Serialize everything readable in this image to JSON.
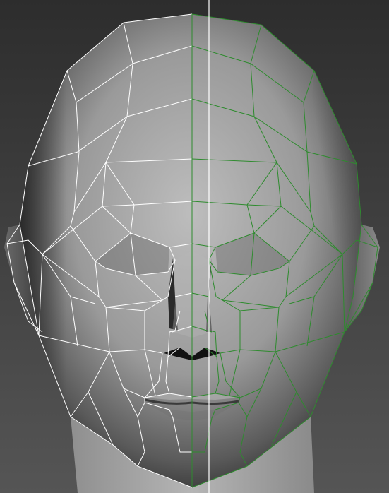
{
  "viewport": {
    "background_color": "#3c3c3c",
    "mesh_shading": "smooth-gray",
    "left_half_wire_color": "#ffffff",
    "right_half_wire_color": "#2e8b2e",
    "mirror_axis_color": "#ffffff",
    "symmetry": "mirror-x",
    "selected_half": "right"
  }
}
